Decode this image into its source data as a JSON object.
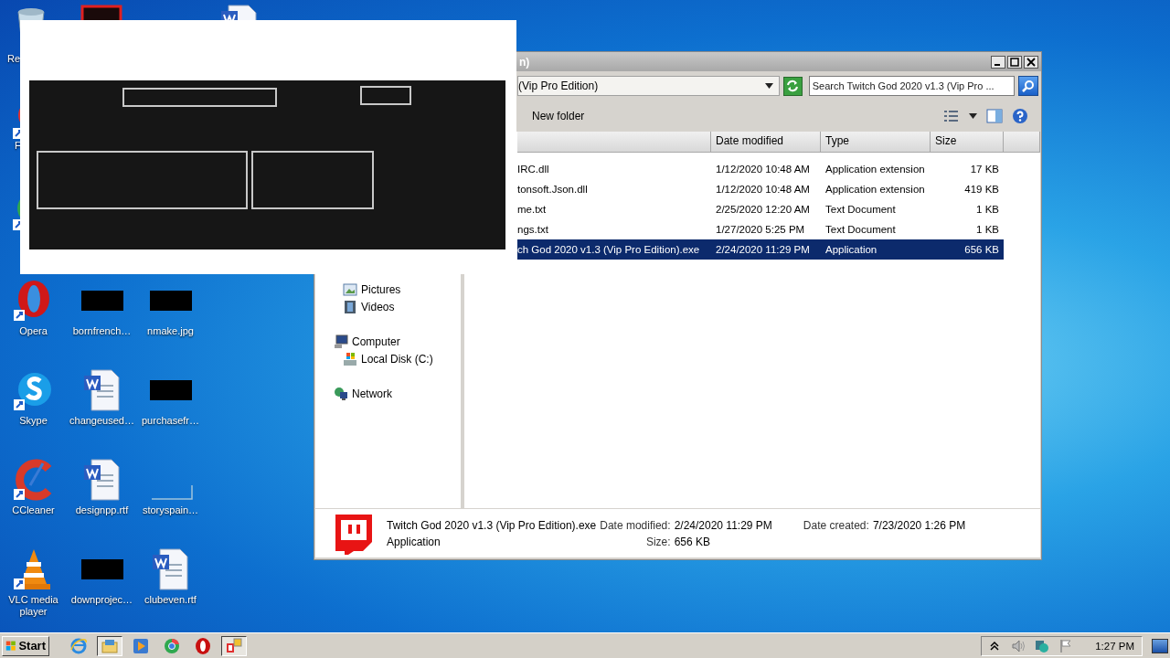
{
  "desktop": {
    "hidden_icons": [
      {
        "kind": "recycle-bin",
        "label": "Re"
      },
      {
        "kind": "red-frame"
      },
      {
        "kind": "word"
      },
      {
        "kind": "red-app",
        "label": "F"
      },
      {
        "kind": "chrome"
      }
    ],
    "icons": [
      {
        "label": "Opera",
        "kind": "opera"
      },
      {
        "label": "bornfrench…",
        "kind": "thumb"
      },
      {
        "label": "nmake.jpg",
        "kind": "thumb"
      },
      {
        "label": "Skype",
        "kind": "skype"
      },
      {
        "label": "changeused…",
        "kind": "word"
      },
      {
        "label": "purchasefr…",
        "kind": "thumb"
      },
      {
        "label": "CCleaner",
        "kind": "ccleaner"
      },
      {
        "label": "designpp.rtf",
        "kind": "word"
      },
      {
        "label": "storyspain…",
        "kind": "blank"
      },
      {
        "label": "VLC media player",
        "kind": "vlc"
      },
      {
        "label": "downprojec…",
        "kind": "thumb"
      },
      {
        "label": "clubeven.rtf",
        "kind": "word"
      }
    ]
  },
  "explorer": {
    "title": "n)",
    "address": "(Vip Pro Edition)",
    "search": {
      "placeholder": "Search Twitch God 2020 v1.3 (Vip Pro ..."
    },
    "toolbar": {
      "new_folder": "New folder"
    },
    "nav": [
      {
        "children": [
          {
            "label": "Pictures",
            "kind": "pictures"
          },
          {
            "label": "Videos",
            "kind": "videos"
          }
        ]
      },
      {
        "label": "Computer",
        "kind": "computer",
        "children": [
          {
            "label": "Local Disk (C:)",
            "kind": "disk"
          }
        ]
      },
      {
        "label": "Network",
        "kind": "network"
      }
    ],
    "columns": [
      "Date modified",
      "Type",
      "Size"
    ],
    "rows": [
      {
        "name": "IRC.dll",
        "date": "1/12/2020 10:48 AM",
        "type": "Application extension",
        "size": "17 KB",
        "selected": false
      },
      {
        "name": "tonsoft.Json.dll",
        "date": "1/12/2020 10:48 AM",
        "type": "Application extension",
        "size": "419 KB",
        "selected": false
      },
      {
        "name": "me.txt",
        "date": "2/25/2020 12:20 AM",
        "type": "Text Document",
        "size": "1 KB",
        "selected": false
      },
      {
        "name": "ngs.txt",
        "date": "1/27/2020 5:25 PM",
        "type": "Text Document",
        "size": "1 KB",
        "selected": false
      },
      {
        "name": "ch God 2020 v1.3 (Vip Pro Edition).exe",
        "date": "2/24/2020 11:29 PM",
        "type": "Application",
        "size": "656 KB",
        "selected": true
      }
    ],
    "details": {
      "name": "Twitch God 2020 v1.3 (Vip Pro Edition).exe",
      "type": "Application",
      "fields": [
        {
          "label": "Date modified:",
          "value": "2/24/2020 11:29 PM"
        },
        {
          "label": "Size:",
          "value": "656 KB"
        },
        {
          "label": "Date created:",
          "value": "7/23/2020 1:26 PM"
        }
      ]
    }
  },
  "taskbar": {
    "start": "Start",
    "apps": [
      {
        "kind": "ie",
        "selected": false
      },
      {
        "kind": "explorer",
        "selected": true
      },
      {
        "kind": "media",
        "selected": false
      },
      {
        "kind": "chrome",
        "selected": false
      },
      {
        "kind": "opera",
        "selected": false
      },
      {
        "kind": "app",
        "selected": true
      }
    ],
    "clock": "1:27 PM"
  }
}
